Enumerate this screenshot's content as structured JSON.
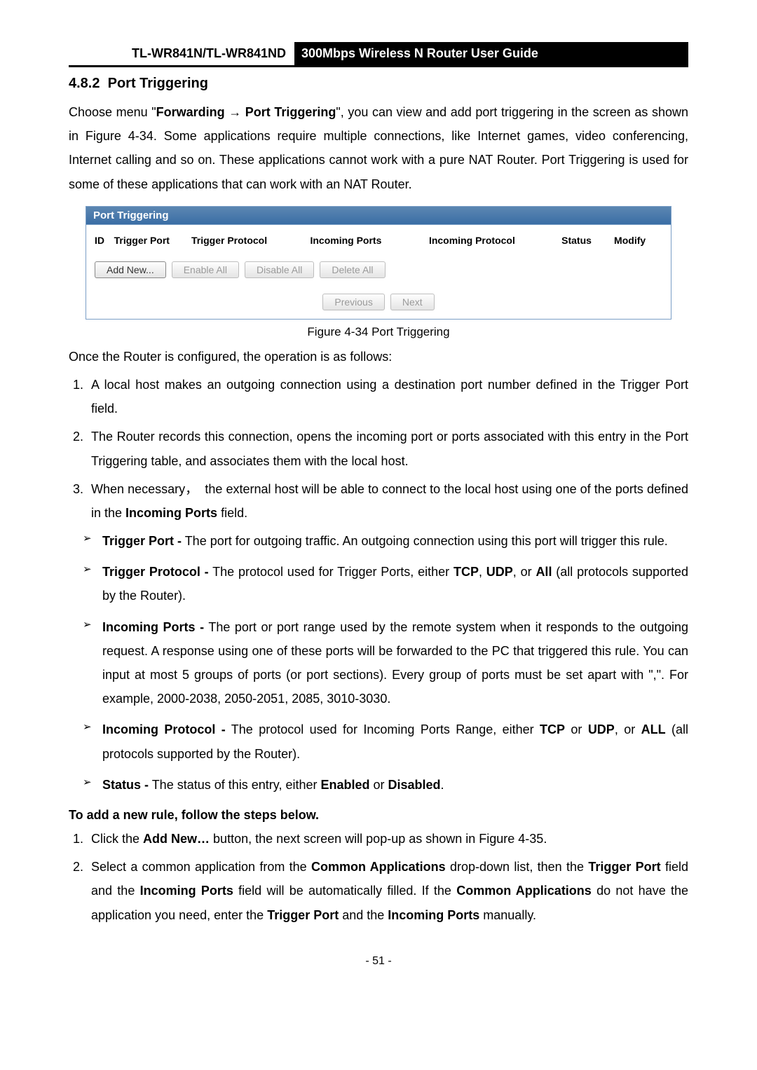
{
  "header": {
    "model": "TL-WR841N/TL-WR841ND",
    "guide": "300Mbps Wireless N Router User Guide"
  },
  "section": {
    "number": "4.8.2",
    "title": "Port Triggering"
  },
  "intro_parts": {
    "p1a": "Choose menu \"",
    "p1b": "Forwarding",
    "p1c": " → ",
    "p1d": "Port Triggering",
    "p1e": "\", you can view and add port triggering in the screen as shown in Figure 4-34. Some applications require multiple connections, like Internet games, video conferencing, Internet calling and so on. These applications cannot work with a pure NAT Router. Port Triggering is used for some of these applications that can work with an NAT Router."
  },
  "panel": {
    "title": "Port Triggering",
    "columns": {
      "id": "ID",
      "trigger_port": "Trigger Port",
      "trigger_protocol": "Trigger Protocol",
      "incoming_ports": "Incoming Ports",
      "incoming_protocol": "Incoming Protocol",
      "status": "Status",
      "modify": "Modify"
    },
    "buttons": {
      "add_new": "Add New...",
      "enable_all": "Enable All",
      "disable_all": "Disable All",
      "delete_all": "Delete All",
      "previous": "Previous",
      "next": "Next"
    }
  },
  "figure_caption": "Figure 4-34   Port Triggering",
  "after_panel": "Once the Router is configured, the operation is as follows:",
  "steps_ol": [
    "A local host makes an outgoing connection using a destination port number defined in the Trigger Port field.",
    "The Router records this connection, opens the incoming port or ports associated with this entry in the Port Triggering table, and associates them with the local host.",
    "When necessary，  the external host will be able to connect to the local host using one of the ports defined in the Incoming Ports field."
  ],
  "defs": {
    "trigger_port": {
      "term": "Trigger Port -",
      "text": " The port for outgoing traffic. An outgoing connection using this port will trigger this rule."
    },
    "trigger_protocol": {
      "term": "Trigger Protocol -",
      "text_a": " The protocol used for Trigger Ports, either ",
      "b1": "TCP",
      "c1": ", ",
      "b2": "UDP",
      "c2": ", or ",
      "b3": "All",
      "text_b": " (all protocols supported by the Router)."
    },
    "incoming_ports": {
      "term": "Incoming Ports -",
      "text": " The port or port range used by the remote system when it responds to the outgoing request. A response using one of these ports will be forwarded to the PC that triggered this rule. You can input at most 5 groups of ports (or port sections). Every group of ports must be set apart with \",\". For example, 2000-2038, 2050-2051, 2085, 3010-3030."
    },
    "incoming_protocol": {
      "term": "Incoming Protocol -",
      "text_a": " The protocol used for Incoming Ports Range, either ",
      "b1": "TCP",
      "c1": " or ",
      "b2": "UDP",
      "c2": ", or ",
      "b3": "ALL",
      "text_b": " (all protocols supported by the Router)."
    },
    "status": {
      "term": "Status -",
      "text_a": " The status of this entry, either ",
      "b1": "Enabled",
      "c1": " or ",
      "b2": "Disabled",
      "c2": "."
    }
  },
  "add_rule_heading": "To add a new rule, follow the steps below.",
  "add_rule_steps": {
    "s1_a": "Click the ",
    "s1_b": "Add New…",
    "s1_c": " button, the next screen will pop-up as shown in Figure 4-35.",
    "s2_a": "Select a common application from the ",
    "s2_b": "Common Applications",
    "s2_c": " drop-down list, then the ",
    "s2_d": "Trigger Port",
    "s2_e": " field and the ",
    "s2_f": "Incoming Ports",
    "s2_g": " field will be automatically filled. If the ",
    "s2_h": "Common Applications",
    "s2_i": " do not have the application you need, enter the ",
    "s2_j": "Trigger Port",
    "s2_k": " and the ",
    "s2_l": "Incoming Ports",
    "s2_m": " manually."
  },
  "page_number": "- 51 -"
}
